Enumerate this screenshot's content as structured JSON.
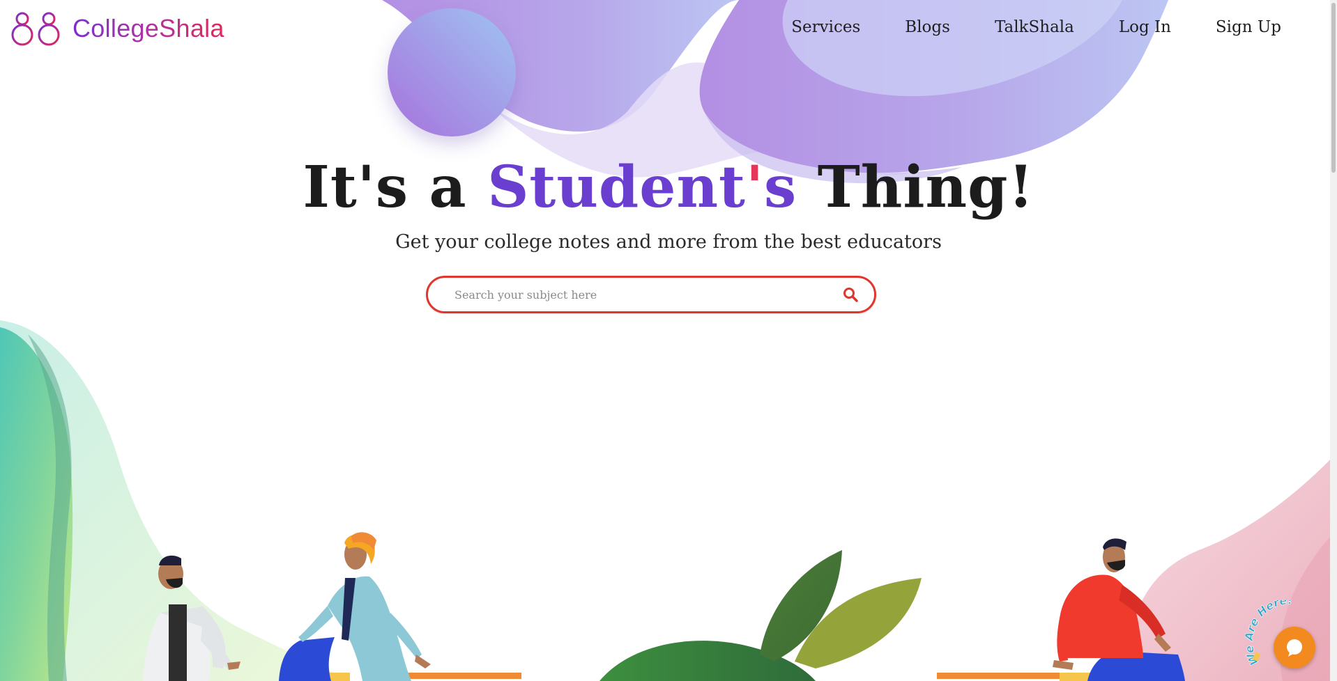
{
  "brand": {
    "name": "CollegeShala",
    "gradient": [
      "#7b2fd0",
      "#e3265a"
    ]
  },
  "nav": {
    "items": [
      {
        "label": "Services"
      },
      {
        "label": "Blogs"
      },
      {
        "label": "TalkShala"
      },
      {
        "label": "Log In"
      },
      {
        "label": "Sign Up"
      }
    ]
  },
  "hero": {
    "title_start": "It's a ",
    "title_accent": "Student",
    "title_apostrophe": "'",
    "title_accent_end": "s",
    "title_end": " Thing!",
    "subtitle": "Get your college notes and more from the best educators",
    "accent_color": "#6a3fcf"
  },
  "search": {
    "placeholder": "Search your subject here",
    "value": "",
    "border_color": "#e0362d",
    "icon": "search-icon"
  },
  "chat_widget": {
    "badge_text": "We Are Here!",
    "icon": "chat-bubble-icon",
    "color": "#f38a1f"
  }
}
